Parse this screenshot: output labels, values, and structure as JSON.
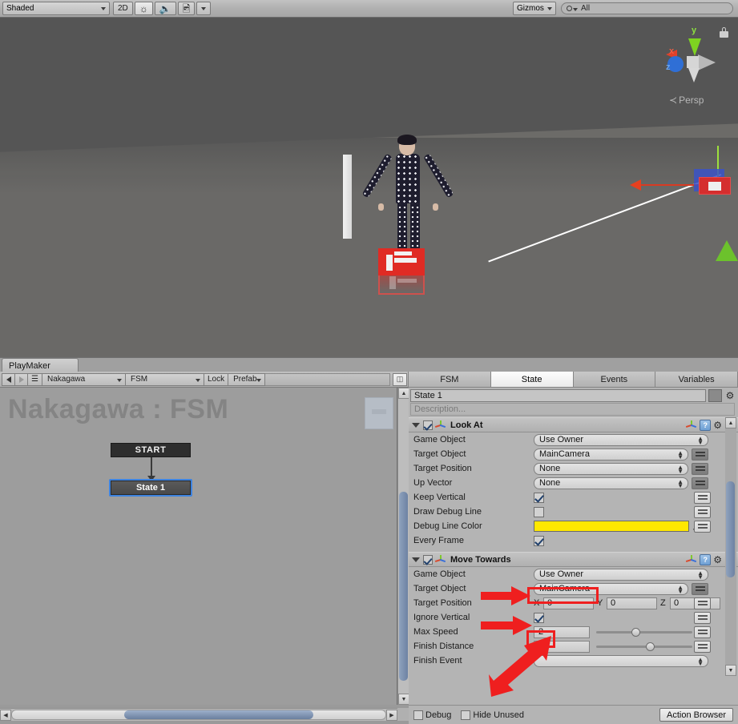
{
  "scene_toolbar": {
    "draw_mode": "Shaded",
    "mode_2d": "2D",
    "lighting_icon": "sun-icon",
    "audio_icon": "speaker-icon",
    "effects_icon": "image-icon",
    "effects_dropdown_icon": "chevron-down-icon",
    "gizmos": "Gizmos",
    "search_placeholder": "All",
    "search_value": "All",
    "search_icon": "search-icon"
  },
  "scene_view": {
    "gizmo": {
      "x_label": "x",
      "y_label": "y",
      "z_label": "z",
      "projection": "Persp",
      "projection_prefix": "≺",
      "lock_icon": "lock-icon"
    }
  },
  "playmaker": {
    "window_tab": "PlayMaker",
    "toolbar": {
      "back_icon": "back-arrow-icon",
      "forward_icon": "forward-arrow-icon",
      "menu_icon": "hamburger-menu-icon",
      "game_object": "Nakagawa",
      "fsm": "FSM",
      "lock": "Lock",
      "prefab": "Prefab",
      "layout_icon": "panel-layout-icon"
    },
    "graph": {
      "title": "Nakagawa : FSM",
      "start_node": "START",
      "state_node": "State 1",
      "minimap_label": "minimap"
    }
  },
  "inspector": {
    "tabs": [
      {
        "label": "FSM",
        "active": false
      },
      {
        "label": "State",
        "active": true
      },
      {
        "label": "Events",
        "active": false
      },
      {
        "label": "Variables",
        "active": false
      }
    ],
    "state_name": "State 1",
    "state_color_swatch": "#8a8a8a",
    "state_gear_icon": "gear-icon",
    "description_placeholder": "Description...",
    "actions": [
      {
        "title": "Look At",
        "enabled": true,
        "expanded": true,
        "icons": [
          "axis-gizmo-icon",
          "help-icon",
          "gear-icon"
        ],
        "properties": [
          {
            "label": "Game Object",
            "type": "popup",
            "value": "Use Owner",
            "binder": false
          },
          {
            "label": "Target Object",
            "type": "popup",
            "value": "MainCamera",
            "binder": true
          },
          {
            "label": "Target Position",
            "type": "popup",
            "value": "None",
            "binder": true
          },
          {
            "label": "Up Vector",
            "type": "popup",
            "value": "None",
            "binder": true
          },
          {
            "label": "Keep Vertical",
            "type": "checkbox",
            "value": true,
            "binder": true
          },
          {
            "label": "Draw Debug Line",
            "type": "checkbox",
            "value": false,
            "binder": true
          },
          {
            "label": "Debug Line Color",
            "type": "color",
            "value": "#ffe800",
            "binder": true,
            "eyedropper_icon": "eyedropper-icon"
          },
          {
            "label": "Every Frame",
            "type": "checkbox",
            "value": true,
            "binder": false
          }
        ]
      },
      {
        "title": "Move Towards",
        "enabled": true,
        "expanded": true,
        "icons": [
          "axis-gizmo-icon",
          "help-icon",
          "gear-icon"
        ],
        "properties": [
          {
            "label": "Game Object",
            "type": "popup",
            "value": "Use Owner",
            "binder": false
          },
          {
            "label": "Target Object",
            "type": "popup",
            "value": "MainCamera",
            "binder": true,
            "highlighted": true
          },
          {
            "label": "Target Position",
            "type": "vector3",
            "x_label": "X",
            "x": "0",
            "y_label": "Y",
            "y": "0",
            "z_label": "Z",
            "z": "0",
            "binder": true
          },
          {
            "label": "Ignore Vertical",
            "type": "checkbox",
            "value": true,
            "binder": true,
            "highlighted": true
          },
          {
            "label": "Max Speed",
            "type": "slider",
            "value": "2",
            "slider_pos": 0.42,
            "binder": true,
            "highlighted": true
          },
          {
            "label": "Finish Distance",
            "type": "slider",
            "value": "1",
            "slider_pos": 0.55,
            "binder": true
          },
          {
            "label": "Finish Event",
            "type": "popup",
            "value": "",
            "binder": false
          }
        ]
      }
    ],
    "footer": {
      "debug_label": "Debug",
      "debug_checked": false,
      "hide_unused_label": "Hide Unused",
      "hide_unused_checked": false,
      "action_browser_label": "Action Browser"
    }
  },
  "annotations": {
    "color": "#ef1f1f",
    "arrows": 3,
    "highlight_boxes": 2
  }
}
